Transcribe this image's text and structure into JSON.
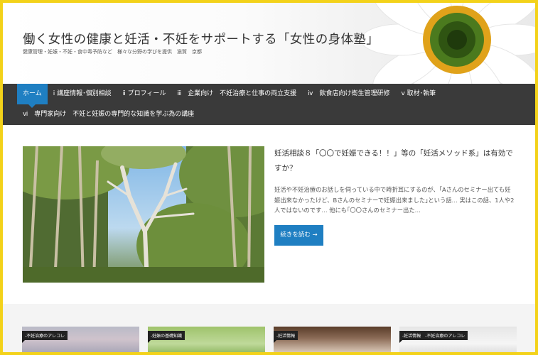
{
  "header": {
    "site_title": "働く女性の健康と妊活・不妊をサポートする「女性の身体塾」",
    "site_description": "健康管理・妊娠・不妊・食中毒予防など　様々な分野の学びを提供　滋賀　京都"
  },
  "nav": {
    "row1": [
      "ホーム",
      "ⅰ 講座情報･個別相談",
      "ⅱ プロフィール",
      "ⅲ　企業向け　不妊治療と仕事の両立支援",
      "ⅳ　飲食店向け衛生管理研修",
      "ⅴ 取材･執筆"
    ],
    "row2": [
      "ⅵ　専門家向け　不妊と妊娠の専門的な知識を学ぶ為の講座"
    ],
    "active_color": "#1f7fc2"
  },
  "featured_post": {
    "title": "妊活相談８「〇〇で妊娠できる！！」等の「妊活メソッド系」は有効ですか？",
    "excerpt": "妊活や不妊治療のお話しを伺っている中で時折耳にするのが、｢Aさんのセミナー出ても妊娠出来なかったけど、Bさんのセミナーで妊娠出来ました｣という話… 実はこの話、1人や2人ではないのです… 他にも｢〇〇さんのセミナー出た…",
    "read_more": "続きを読む →"
  },
  "cards": [
    {
      "tag": "-不妊治療のアレコレ"
    },
    {
      "tag": "-妊娠の基礎知識"
    },
    {
      "tag": "-妊活情報"
    },
    {
      "tag": "-妊活情報　-不妊治療のアレコレ"
    }
  ],
  "colors": {
    "border": "#f3d21a",
    "nav_bg": "#3a3a3a",
    "accent": "#1f7fc2"
  }
}
